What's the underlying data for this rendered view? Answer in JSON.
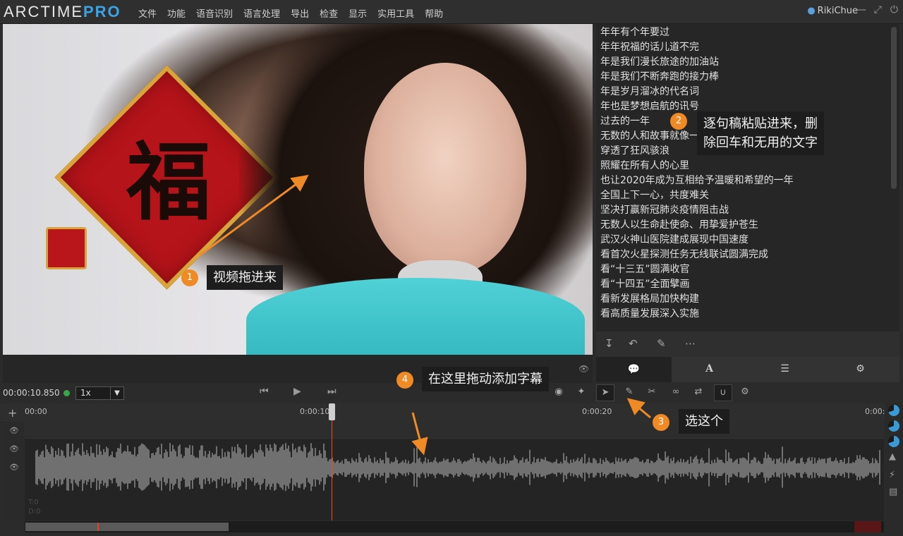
{
  "app": {
    "logo_main": "ARCTIME",
    "logo_pro": "PRO",
    "menu": [
      "文件",
      "功能",
      "语音识别",
      "语言处理",
      "导出",
      "检查",
      "显示",
      "实用工具",
      "帮助"
    ],
    "user": "RikiChue"
  },
  "script_lines": [
    "年年有个年要过",
    "年年祝福的话儿道不完",
    "年是我们漫长旅途的加油站",
    "年是我们不断奔跑的接力棒",
    "年是岁月溜冰的代名词",
    "年也是梦想启航的讯号",
    "过去的一年",
    "无数的人和故事就像一首歌",
    "穿透了狂风骇浪",
    "照耀在所有人的心里",
    "也让2020年成为互相给予温暖和希望的一年",
    "全国上下一心，共度难关",
    "坚决打赢新冠肺炎疫情阻击战",
    "无数人以生命赴使命、用挚爱护苍生",
    "武汉火神山医院建成展现中国速度",
    "看首次火星探测任务无线联试圆满完成",
    "看“十三五”圆满收官",
    "看“十四五”全面擘画",
    "看新发展格局加快构建",
    "看高质量发展深入实施"
  ],
  "transport": {
    "timecode": "00:00:10.850",
    "speed": "1x"
  },
  "ruler": [
    "00:00",
    "0:00:10",
    "0:00:20",
    "0:00:"
  ],
  "annotations": {
    "a1": {
      "num": "1",
      "text": "视频拖进来"
    },
    "a2": {
      "num": "2",
      "text_line1": "逐句稿粘贴进来，删",
      "text_line2": "除回车和无用的文字"
    },
    "a3": {
      "num": "3",
      "text": "选这个"
    },
    "a4": {
      "num": "4",
      "text": "在这里拖动添加字幕"
    }
  },
  "colors": {
    "accent": "#3aa4e6",
    "annotation": "#f08a24",
    "playhead": "#e0502c"
  },
  "track_labels": {
    "t0": "T:0",
    "t0b": "D:0"
  }
}
